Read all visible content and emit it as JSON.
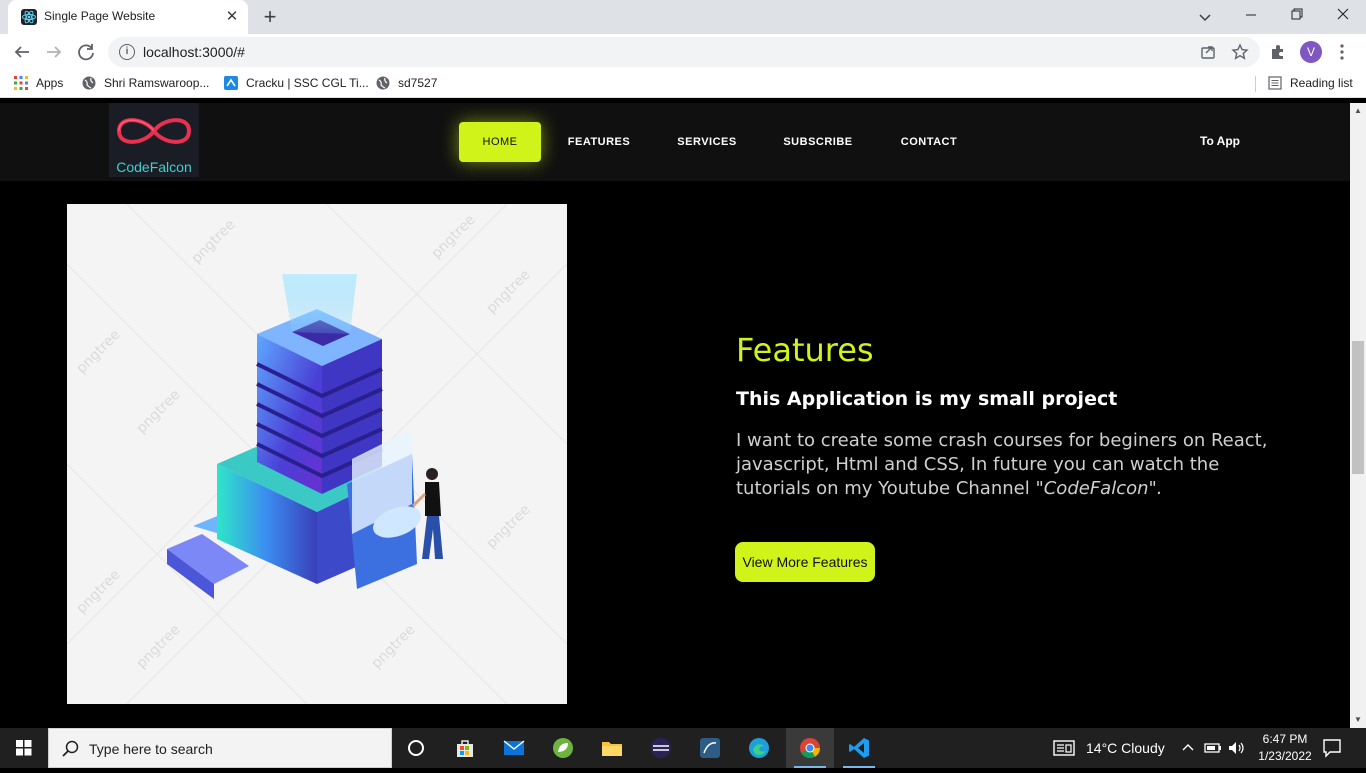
{
  "browser": {
    "tab_title": "Single Page Website",
    "tab_close": "✕",
    "new_tab": "+",
    "url": "localhost:3000/#",
    "profile_initial": "V",
    "bookmarks": [
      {
        "label": "Apps",
        "icon": "apps-grid-icon"
      },
      {
        "label": "Shri Ramswaroop...",
        "icon": "globe-icon"
      },
      {
        "label": "Cracku | SSC CGL Ti...",
        "icon": "cracku-icon"
      },
      {
        "label": "sd7527",
        "icon": "globe-icon"
      }
    ],
    "reading_list": "Reading list"
  },
  "site": {
    "logo_text": "CodeFalcon",
    "nav": [
      {
        "label": "HOME",
        "active": true
      },
      {
        "label": "FEATURES",
        "active": false
      },
      {
        "label": "SERVICES",
        "active": false
      },
      {
        "label": "SUBSCRIBE",
        "active": false
      },
      {
        "label": "CONTACT",
        "active": false
      }
    ],
    "to_app": "To App",
    "accent": "#d0f41a",
    "features": {
      "title": "Features",
      "subtitle": "This Application is my small project",
      "description": "I want to create some crash courses for beginers on React, javascript, Html and CSS, In future you can watch the tutorials on my Youtube Channel ",
      "channel": "\"CodeFalcon\".",
      "button": "View More Features"
    },
    "watermark": "pngtree"
  },
  "taskbar": {
    "search_placeholder": "Type here to search",
    "weather": "14°C  Cloudy",
    "time": "6:47 PM",
    "date": "1/23/2022"
  }
}
